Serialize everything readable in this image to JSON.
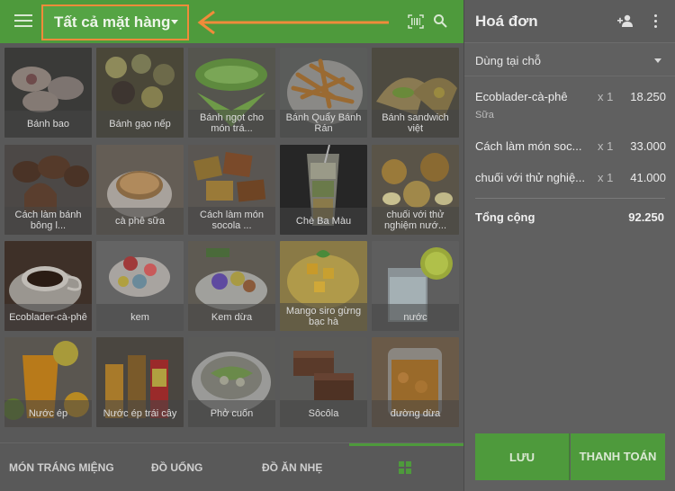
{
  "header": {
    "category": "Tất cả mặt hàng"
  },
  "products": [
    {
      "label": "Bánh bao"
    },
    {
      "label": "Bánh gạo nếp"
    },
    {
      "label": "Bánh ngọt cho món trá..."
    },
    {
      "label": "Bánh Quẩy Bánh Rán"
    },
    {
      "label": "Bánh sandwich việt"
    },
    {
      "label": "Cách làm bánh bông l..."
    },
    {
      "label": "cà phê sữa"
    },
    {
      "label": "Cách làm món socola ..."
    },
    {
      "label": "Chè Ba Màu"
    },
    {
      "label": "chuối với thử nghiệm nướ..."
    },
    {
      "label": "Ecoblader-cà-phê"
    },
    {
      "label": "kem"
    },
    {
      "label": "Kem dừa"
    },
    {
      "label": "Mango siro gừng bạc hà"
    },
    {
      "label": "nước"
    },
    {
      "label": "Nước ép"
    },
    {
      "label": "Nước ép trái cây"
    },
    {
      "label": "Phở cuốn"
    },
    {
      "label": "Sôcôla"
    },
    {
      "label": "đường dừa"
    }
  ],
  "bottom_tabs": [
    {
      "label": "MÓN TRÁNG MIỆNG"
    },
    {
      "label": "ĐỒ UỐNG"
    },
    {
      "label": "ĐỒ ĂN NHẸ"
    }
  ],
  "invoice": {
    "title": "Hoá đơn",
    "dine_option": "Dùng tại chỗ",
    "lines": [
      {
        "name": "Ecoblader-cà-phê",
        "qty": "x 1",
        "price": "18.250",
        "note": "Sữa"
      },
      {
        "name": "Cách làm món soc...",
        "qty": "x 1",
        "price": "33.000",
        "note": ""
      },
      {
        "name": "chuối với thử nghiệ...",
        "qty": "x 1",
        "price": "41.000",
        "note": ""
      }
    ],
    "total_label": "Tổng cộng",
    "total_value": "92.250",
    "save_label": "LƯU",
    "pay_label": "THANH TOÁN"
  },
  "colors": {
    "accent": "#4e9a3c",
    "highlight": "#f08b3a"
  }
}
